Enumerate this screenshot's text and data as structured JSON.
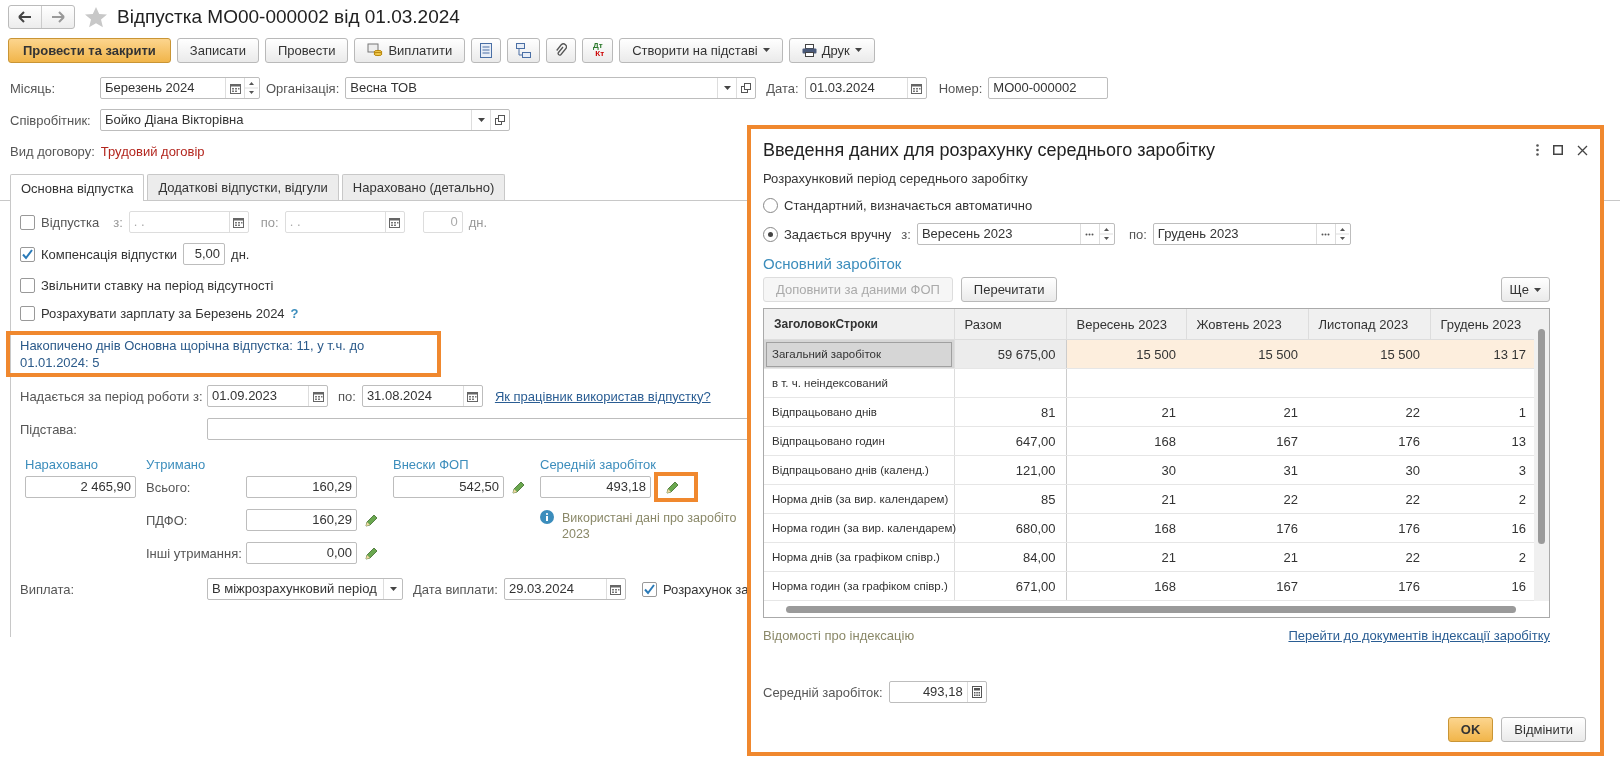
{
  "window": {
    "title": "Відпустка МО00-000002 від 01.03.2024",
    "favorite": false
  },
  "toolbar": [
    {
      "kind": "primary",
      "label": "Провести та закрити"
    },
    {
      "kind": "button",
      "label": "Записати"
    },
    {
      "kind": "button",
      "label": "Провести"
    },
    {
      "kind": "button",
      "label": "Виплатити"
    },
    {
      "kind": "icon"
    },
    {
      "kind": "icon"
    },
    {
      "kind": "icon"
    },
    {
      "kind": "dtkt",
      "top": "Дт",
      "bottom": "Кт"
    },
    {
      "kind": "menu",
      "label": "Створити на підставі"
    },
    {
      "kind": "menu",
      "label": "Друк"
    }
  ],
  "header": {
    "month": {
      "label": "Місяць:",
      "value": "Березень 2024"
    },
    "organization": {
      "label": "Організація:",
      "value": "Весна ТОВ"
    },
    "date": {
      "label": "Дата:",
      "value": "01.03.2024"
    },
    "number": {
      "label": "Номер:",
      "value": "МО00-000002"
    },
    "employee": {
      "label": "Співробітник:",
      "value": "Бойко Діана Вікторівна"
    },
    "contract": {
      "label": "Вид договору:",
      "value": "Трудовий договір"
    }
  },
  "tabs": [
    {
      "label": "Основна відпустка",
      "selected": true
    },
    {
      "label": "Додаткові відпустки, відгули",
      "selected": false
    },
    {
      "label": "Нараховано (детально)",
      "selected": false
    }
  ],
  "tab_content": {
    "vacation": {
      "checked": false,
      "disabled": true,
      "label": "Відпустка",
      "from_label": "з:",
      "from": ". .",
      "to_label": "по:",
      "to": ". .",
      "days": "0",
      "unit": "дн."
    },
    "compensation": {
      "checked": true,
      "label": "Компенсація відпустки",
      "value": "5,00",
      "unit": "дн."
    },
    "release": {
      "checked": false,
      "label": "Звільнити ставку на період відсутності"
    },
    "calc_salary": {
      "checked": false,
      "label": "Розрахувати зарплату за Березень 2024",
      "help": "?"
    },
    "accrued_note": "Накопичено днів Основна щорічна відпустка: 11, у т.ч. до 01.01.2024: 5",
    "period": {
      "label": "Надається за період роботи з:",
      "from": "01.09.2023",
      "to_label": "по:",
      "to": "31.08.2024",
      "link": "Як працівник використав відпустку?"
    },
    "basis": {
      "label": "Підстава:"
    },
    "accrued": {
      "label": "Нараховано",
      "value": "2 465,90"
    },
    "withheld": {
      "label": "Утримано",
      "rows": [
        {
          "label": "Всього:",
          "value": "160,29",
          "editable": false
        },
        {
          "label": "ПДФО:",
          "value": "160,29",
          "editable": true
        },
        {
          "label": "Інші утримання:",
          "value": "0,00",
          "editable": true
        }
      ]
    },
    "contributions": {
      "label": "Внески ФОП",
      "value": "542,50"
    },
    "average": {
      "label": "Середній заробіток",
      "value": "493,18",
      "note_lines": [
        "Використані дані про заробіто",
        "2023"
      ]
    },
    "payment": {
      "label": "Виплата:",
      "value": "В міжрозрахунковий період",
      "date_label": "Дата виплати:",
      "date": "29.03.2024",
      "checkbox": {
        "checked": true,
        "label": "Розрахунок за"
      }
    }
  },
  "dialog": {
    "title": "Введення даних для розрахунку середнього заробітку",
    "period_label": "Розрахунковий період середнього заробітку",
    "period_options": [
      {
        "label": "Стандартний, визначається автоматично",
        "selected": false
      },
      {
        "label": "Задається вручну",
        "selected": true
      }
    ],
    "from_label": "з:",
    "from": "Вересень 2023",
    "to_label": "по:",
    "to": "Грудень 2023",
    "section": "Основний заробіток",
    "buttons": [
      {
        "label": "Доповнити за даними ФОП",
        "disabled": true
      },
      {
        "label": "Перечитати",
        "disabled": false
      }
    ],
    "more": "Ще",
    "table": {
      "columns": [
        "ЗаголовокСтроки",
        "Разом",
        "Вересень 2023",
        "Жовтень 2023",
        "Листопад 2023",
        "Грудень 2023"
      ],
      "rows": [
        {
          "label": "Загальний заробіток",
          "selected": true,
          "total": "59 675,00",
          "months": [
            "15 500",
            "15 500",
            "15 500",
            "13 17"
          ]
        },
        {
          "label": "в т. ч. неіндексований",
          "selected": false
        },
        {
          "label": "Відпрацьовано днів",
          "selected": false,
          "total": "81",
          "months": [
            "21",
            "21",
            "22",
            "1"
          ]
        },
        {
          "label": "Відпрацьовано годин",
          "selected": false,
          "total": "647,00",
          "months": [
            "168",
            "167",
            "176",
            "13"
          ]
        },
        {
          "label": "Відпрацьовано днів (календ.)",
          "selected": false,
          "total": "121,00",
          "months": [
            "30",
            "31",
            "30",
            "3"
          ]
        },
        {
          "label": "Норма днів (за вир. календарем)",
          "selected": false,
          "total": "85",
          "months": [
            "21",
            "22",
            "22",
            "2"
          ]
        },
        {
          "label": "Норма годин (за вир. календарем)",
          "selected": false,
          "total": "680,00",
          "months": [
            "168",
            "176",
            "176",
            "16"
          ]
        },
        {
          "label": "Норма днів (за графіком співр.)",
          "selected": false,
          "total": "84,00",
          "months": [
            "21",
            "21",
            "22",
            "2"
          ]
        },
        {
          "label": "Норма годин (за графіком співр.)",
          "selected": false,
          "total": "671,00",
          "months": [
            "168",
            "167",
            "176",
            "16"
          ]
        }
      ]
    },
    "indexing_note": "Відомості про індексацію",
    "indexing_link": "Перейти до документів індексації заробітку",
    "average_label": "Середній заробіток:",
    "average_value": "493,18",
    "ok": "OK",
    "cancel": "Відмінити"
  }
}
